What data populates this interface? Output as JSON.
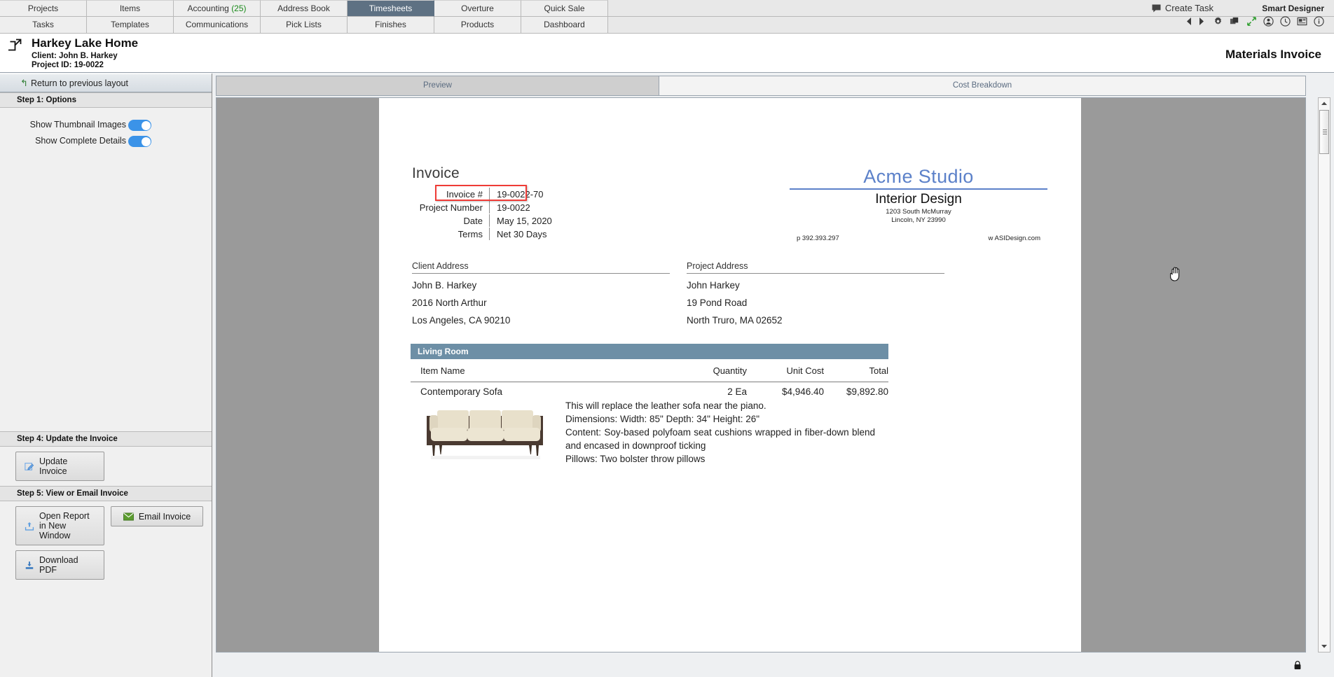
{
  "topnav": {
    "row1": [
      {
        "label": "Projects",
        "active": false
      },
      {
        "label": "Items",
        "active": false
      },
      {
        "label": "Accounting",
        "badge": "(25)",
        "active": false
      },
      {
        "label": "Address Book",
        "active": false
      },
      {
        "label": "Timesheets",
        "active": true
      },
      {
        "label": "Overture",
        "active": false
      },
      {
        "label": "Quick Sale",
        "active": false
      }
    ],
    "row2": [
      {
        "label": "Tasks",
        "active": false
      },
      {
        "label": "Templates",
        "active": false
      },
      {
        "label": "Communications",
        "active": false
      },
      {
        "label": "Pick Lists",
        "active": false
      },
      {
        "label": "Finishes",
        "active": false
      },
      {
        "label": "Products",
        "active": false
      },
      {
        "label": "Dashboard",
        "active": false
      }
    ],
    "create_task": "Create Task",
    "create_task_icon": "speech-bubble-icon",
    "smart_designer": "Smart Designer",
    "icons": [
      "nav-back-icon",
      "nav-forward-icon",
      "gear-icon",
      "copy-windows-icon",
      "expand-arrows-icon",
      "user-icon",
      "clock-icon",
      "report-icon",
      "info-icon"
    ]
  },
  "project_header": {
    "open_external_icon": "open-in-new-window-icon",
    "title": "Harkey Lake Home",
    "client": "Client: John B. Harkey",
    "project_id": "Project ID: 19-0022",
    "document_title": "Materials Invoice"
  },
  "sidebar": {
    "return_link": "Return to previous layout",
    "return_icon": "back-arrow-icon",
    "step1_header": "Step 1: Options",
    "options": [
      {
        "label": "Show Thumbnail Images",
        "state": "on"
      },
      {
        "label": "Show Complete Details",
        "state": "on"
      }
    ],
    "step4_header": "Step 4: Update the Invoice",
    "update_invoice_label": "Update Invoice",
    "update_invoice_icon": "edit-pencil-icon",
    "step5_header": "Step 5: View or Email Invoice",
    "open_report_label": "Open Report in New Window",
    "open_report_icon": "upload-box-icon",
    "email_invoice_label": "Email Invoice",
    "email_invoice_icon": "envelope-icon",
    "download_pdf_label": "Download PDF",
    "download_pdf_icon": "download-box-icon"
  },
  "tabs": [
    {
      "label": "Preview",
      "active": true
    },
    {
      "label": "Cost Breakdown",
      "active": false
    }
  ],
  "invoice": {
    "heading": "Invoice",
    "meta": [
      {
        "label": "Invoice #",
        "value": "19-0022-70",
        "highlighted": true
      },
      {
        "label": "Project Number",
        "value": "19-0022",
        "highlighted": false
      },
      {
        "label": "Date",
        "value": "May 15, 2020",
        "highlighted": false
      },
      {
        "label": "Terms",
        "value": "Net 30 Days",
        "highlighted": false
      }
    ],
    "logo": {
      "name": "Acme Studio",
      "subtitle": "Interior Design",
      "address_line1": "1203 South McMurray",
      "address_line2": "Lincoln, NY 23990",
      "phone": "p 392.393.297",
      "web": "w ASIDesign.com",
      "accent_color": "#5c81c9"
    },
    "client_address": {
      "title": "Client Address",
      "lines": [
        "John B. Harkey",
        "2016 North Arthur",
        "Los Angeles, CA 90210"
      ]
    },
    "project_address": {
      "title": "Project Address",
      "lines": [
        "John Harkey",
        "19 Pond Road",
        "North Truro, MA 02652"
      ]
    },
    "room_name": "Living Room",
    "room_bar_color": "#6d8fa6",
    "columns": [
      "Item Name",
      "Quantity",
      "Unit Cost",
      "Total"
    ],
    "rows": [
      {
        "name": "Contemporary Sofa",
        "quantity": "2  Ea",
        "unit_cost": "$4,946.40",
        "total": "$9,892.80",
        "thumbnail": "contemporary-sofa-thumbnail",
        "description": [
          "This will replace the leather sofa near the piano.",
          "Dimensions: Width: 85\"  Depth: 34\"  Height: 26\"",
          "Content: Soy-based polyfoam seat cushions wrapped in fiber-down blend and encased in downproof ticking",
          "Pillows: Two bolster throw pillows"
        ]
      }
    ]
  },
  "statusbar": {
    "lock_icon": "lock-icon"
  },
  "cursor": {
    "type": "grab-hand-cursor"
  }
}
